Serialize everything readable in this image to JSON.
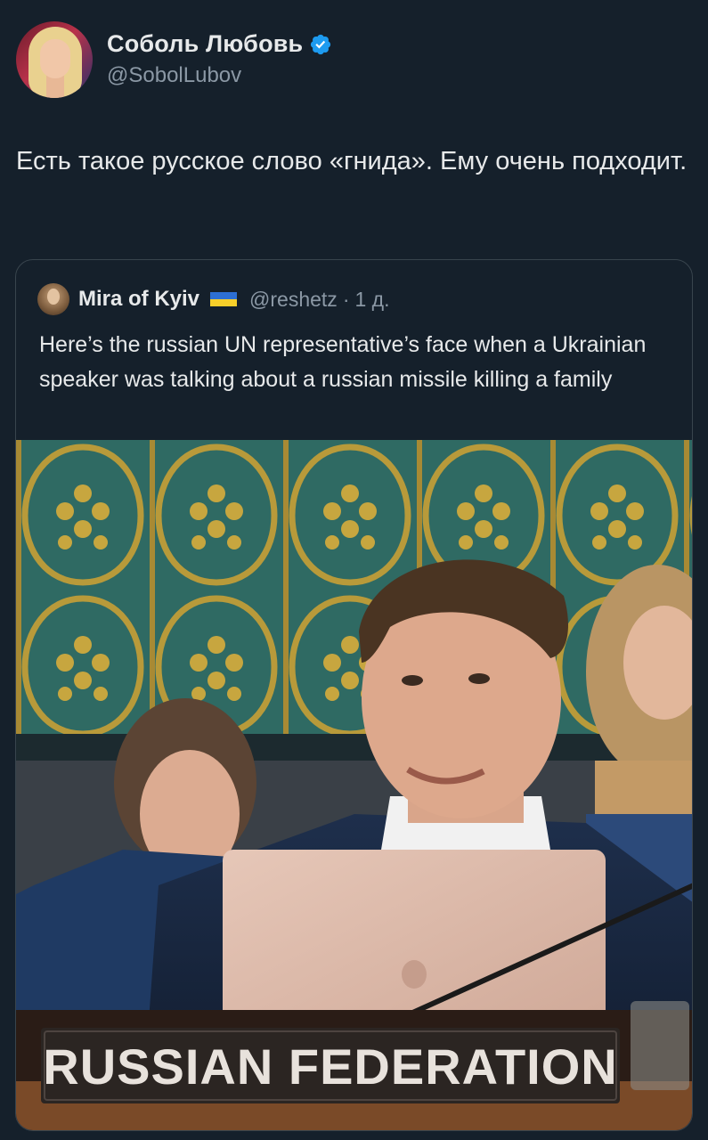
{
  "author": {
    "display_name": "Соболь Любовь",
    "handle": "@SobolLubov",
    "verified": true,
    "avatar_icon": "profile-photo"
  },
  "tweet": {
    "text": "Есть такое русское слово «гнида». Ему очень подходит."
  },
  "quoted_tweet": {
    "display_name": "Mira of Kyiv",
    "flag": "ukraine-flag",
    "handle": "@reshetz",
    "separator": "·",
    "time": "1 д.",
    "text": "Here’s the russian UN representative’s face when a Ukrainian speaker was talking about a russian missile killing a family",
    "media": {
      "nameplate": "RUSSIAN FEDERATION"
    }
  },
  "colors": {
    "background": "#15202b",
    "primary_text": "#e7e9ea",
    "secondary_text": "#8b98a5",
    "border": "#38444d",
    "verified": "#1d9bf0"
  }
}
